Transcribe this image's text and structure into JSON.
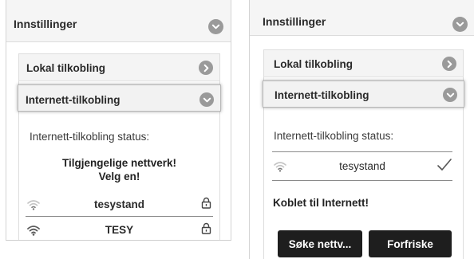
{
  "left": {
    "top_title": "Innstillinger",
    "sub_local": "Lokal tilkobling",
    "sub_internet": "Internett-tilkobling",
    "status_label": "Internett-tilkobling status:",
    "notice_line1": "Tilgjengelige nettverk!",
    "notice_line2": "Velg en!",
    "networks": [
      {
        "ssid": "tesystand",
        "signal": "weak",
        "locked": true
      },
      {
        "ssid": "TESY",
        "signal": "strong",
        "locked": true
      }
    ]
  },
  "right": {
    "top_title": "Innstillinger",
    "sub_local": "Lokal tilkobling",
    "sub_internet": "Internett-tilkobling",
    "status_label": "Internett-tilkobling status:",
    "connected_network": "tesystand",
    "connected_msg": "Koblet til Internett!",
    "btn_search": "Søke nettv...",
    "btn_refresh": "Forfriske"
  },
  "icons": {
    "chevron_down": "chevron-down-icon",
    "chevron_right": "chevron-right-icon",
    "wifi": "wifi-icon",
    "lock": "lock-icon",
    "check": "checkmark-icon"
  },
  "colors": {
    "button_bg": "#1e1e1e",
    "icon_circle": "#9a9a9a"
  }
}
